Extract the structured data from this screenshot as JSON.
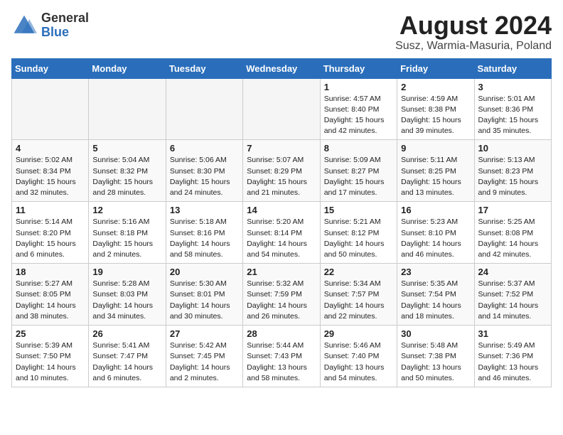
{
  "header": {
    "logo_general": "General",
    "logo_blue": "Blue",
    "title": "August 2024",
    "location": "Susz, Warmia-Masuria, Poland"
  },
  "weekdays": [
    "Sunday",
    "Monday",
    "Tuesday",
    "Wednesday",
    "Thursday",
    "Friday",
    "Saturday"
  ],
  "weeks": [
    [
      {
        "day": "",
        "info": ""
      },
      {
        "day": "",
        "info": ""
      },
      {
        "day": "",
        "info": ""
      },
      {
        "day": "",
        "info": ""
      },
      {
        "day": "1",
        "info": "Sunrise: 4:57 AM\nSunset: 8:40 PM\nDaylight: 15 hours\nand 42 minutes."
      },
      {
        "day": "2",
        "info": "Sunrise: 4:59 AM\nSunset: 8:38 PM\nDaylight: 15 hours\nand 39 minutes."
      },
      {
        "day": "3",
        "info": "Sunrise: 5:01 AM\nSunset: 8:36 PM\nDaylight: 15 hours\nand 35 minutes."
      }
    ],
    [
      {
        "day": "4",
        "info": "Sunrise: 5:02 AM\nSunset: 8:34 PM\nDaylight: 15 hours\nand 32 minutes."
      },
      {
        "day": "5",
        "info": "Sunrise: 5:04 AM\nSunset: 8:32 PM\nDaylight: 15 hours\nand 28 minutes."
      },
      {
        "day": "6",
        "info": "Sunrise: 5:06 AM\nSunset: 8:30 PM\nDaylight: 15 hours\nand 24 minutes."
      },
      {
        "day": "7",
        "info": "Sunrise: 5:07 AM\nSunset: 8:29 PM\nDaylight: 15 hours\nand 21 minutes."
      },
      {
        "day": "8",
        "info": "Sunrise: 5:09 AM\nSunset: 8:27 PM\nDaylight: 15 hours\nand 17 minutes."
      },
      {
        "day": "9",
        "info": "Sunrise: 5:11 AM\nSunset: 8:25 PM\nDaylight: 15 hours\nand 13 minutes."
      },
      {
        "day": "10",
        "info": "Sunrise: 5:13 AM\nSunset: 8:23 PM\nDaylight: 15 hours\nand 9 minutes."
      }
    ],
    [
      {
        "day": "11",
        "info": "Sunrise: 5:14 AM\nSunset: 8:20 PM\nDaylight: 15 hours\nand 6 minutes."
      },
      {
        "day": "12",
        "info": "Sunrise: 5:16 AM\nSunset: 8:18 PM\nDaylight: 15 hours\nand 2 minutes."
      },
      {
        "day": "13",
        "info": "Sunrise: 5:18 AM\nSunset: 8:16 PM\nDaylight: 14 hours\nand 58 minutes."
      },
      {
        "day": "14",
        "info": "Sunrise: 5:20 AM\nSunset: 8:14 PM\nDaylight: 14 hours\nand 54 minutes."
      },
      {
        "day": "15",
        "info": "Sunrise: 5:21 AM\nSunset: 8:12 PM\nDaylight: 14 hours\nand 50 minutes."
      },
      {
        "day": "16",
        "info": "Sunrise: 5:23 AM\nSunset: 8:10 PM\nDaylight: 14 hours\nand 46 minutes."
      },
      {
        "day": "17",
        "info": "Sunrise: 5:25 AM\nSunset: 8:08 PM\nDaylight: 14 hours\nand 42 minutes."
      }
    ],
    [
      {
        "day": "18",
        "info": "Sunrise: 5:27 AM\nSunset: 8:05 PM\nDaylight: 14 hours\nand 38 minutes."
      },
      {
        "day": "19",
        "info": "Sunrise: 5:28 AM\nSunset: 8:03 PM\nDaylight: 14 hours\nand 34 minutes."
      },
      {
        "day": "20",
        "info": "Sunrise: 5:30 AM\nSunset: 8:01 PM\nDaylight: 14 hours\nand 30 minutes."
      },
      {
        "day": "21",
        "info": "Sunrise: 5:32 AM\nSunset: 7:59 PM\nDaylight: 14 hours\nand 26 minutes."
      },
      {
        "day": "22",
        "info": "Sunrise: 5:34 AM\nSunset: 7:57 PM\nDaylight: 14 hours\nand 22 minutes."
      },
      {
        "day": "23",
        "info": "Sunrise: 5:35 AM\nSunset: 7:54 PM\nDaylight: 14 hours\nand 18 minutes."
      },
      {
        "day": "24",
        "info": "Sunrise: 5:37 AM\nSunset: 7:52 PM\nDaylight: 14 hours\nand 14 minutes."
      }
    ],
    [
      {
        "day": "25",
        "info": "Sunrise: 5:39 AM\nSunset: 7:50 PM\nDaylight: 14 hours\nand 10 minutes."
      },
      {
        "day": "26",
        "info": "Sunrise: 5:41 AM\nSunset: 7:47 PM\nDaylight: 14 hours\nand 6 minutes."
      },
      {
        "day": "27",
        "info": "Sunrise: 5:42 AM\nSunset: 7:45 PM\nDaylight: 14 hours\nand 2 minutes."
      },
      {
        "day": "28",
        "info": "Sunrise: 5:44 AM\nSunset: 7:43 PM\nDaylight: 13 hours\nand 58 minutes."
      },
      {
        "day": "29",
        "info": "Sunrise: 5:46 AM\nSunset: 7:40 PM\nDaylight: 13 hours\nand 54 minutes."
      },
      {
        "day": "30",
        "info": "Sunrise: 5:48 AM\nSunset: 7:38 PM\nDaylight: 13 hours\nand 50 minutes."
      },
      {
        "day": "31",
        "info": "Sunrise: 5:49 AM\nSunset: 7:36 PM\nDaylight: 13 hours\nand 46 minutes."
      }
    ]
  ]
}
